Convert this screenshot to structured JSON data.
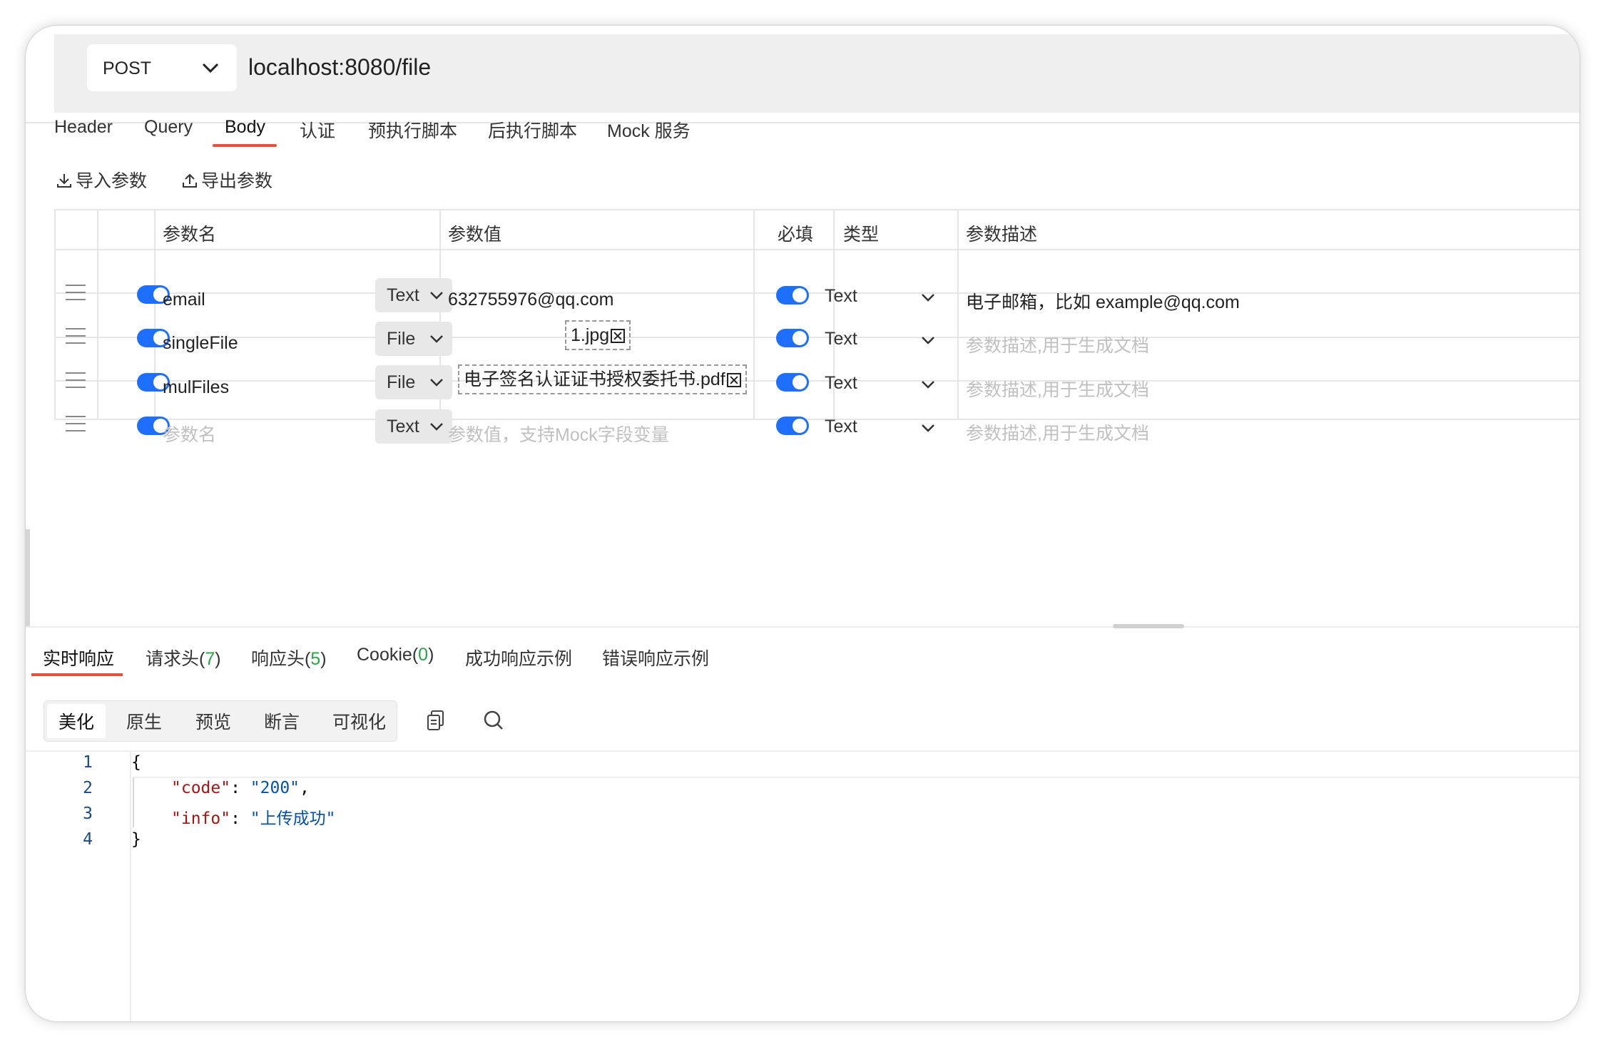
{
  "request": {
    "method": "POST",
    "url": "localhost:8080/file"
  },
  "request_tabs": [
    "Header",
    "Query",
    "Body",
    "认证",
    "预执行脚本",
    "后执行脚本",
    "Mock 服务"
  ],
  "active_request_tab": "Body",
  "toolbar": {
    "import_label": "导入参数",
    "export_label": "导出参数"
  },
  "params_table": {
    "headers": {
      "name": "参数名",
      "value": "参数值",
      "required": "必填",
      "type": "类型",
      "description": "参数描述"
    },
    "rows": [
      {
        "enabled": true,
        "name": "email",
        "name_placeholder": false,
        "kind": "Text",
        "value": "632755976@qq.com",
        "value_kind": "text",
        "required": true,
        "type": "Text",
        "description": "电子邮箱，比如 example@qq.com",
        "description_placeholder": false
      },
      {
        "enabled": true,
        "name": "singleFile",
        "name_placeholder": false,
        "kind": "File",
        "value": "1.jpg",
        "value_kind": "file",
        "required": true,
        "type": "Text",
        "description": "参数描述,用于生成文档",
        "description_placeholder": true
      },
      {
        "enabled": true,
        "name": "mulFiles",
        "name_placeholder": false,
        "kind": "File",
        "value": "电子签名认证证书授权委托书.pdf",
        "value_kind": "file",
        "required": true,
        "type": "Text",
        "description": "参数描述,用于生成文档",
        "description_placeholder": true
      },
      {
        "enabled": true,
        "name": "参数名",
        "name_placeholder": true,
        "kind": "Text",
        "value": "参数值，支持Mock字段变量",
        "value_kind": "placeholder",
        "required": true,
        "type": "Text",
        "description": "参数描述,用于生成文档",
        "description_placeholder": true
      }
    ]
  },
  "response_tabs": {
    "realtime": "实时响应",
    "req_headers": "请求头(",
    "req_headers_count": "7",
    "resp_headers": "响应头(",
    "resp_headers_count": "5",
    "cookie": "Cookie(",
    "cookie_count": "0",
    "close_paren": ")",
    "success_example": "成功响应示例",
    "error_example": "错误响应示例"
  },
  "view_modes": [
    "美化",
    "原生",
    "预览",
    "断言",
    "可视化"
  ],
  "active_view_mode": "美化",
  "colors": {
    "accent": "#e8503a",
    "toggle": "#1f6fff",
    "count": "#2aa34a"
  },
  "response_body": {
    "line_numbers": [
      "1",
      "2",
      "3",
      "4"
    ],
    "open_brace": "{",
    "close_brace": "}",
    "key1": "\"code\"",
    "val1": "\"200\"",
    "key2": "\"info\"",
    "val2": "\"上传成功\"",
    "colon": ": ",
    "comma": ","
  }
}
